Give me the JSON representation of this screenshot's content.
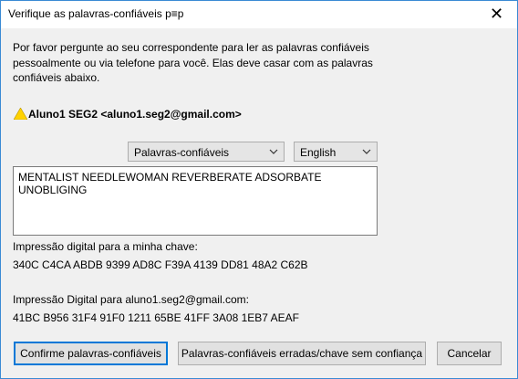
{
  "window": {
    "title": "Verifique as palavras-confiáveis p≡p",
    "close_glyph": "✕"
  },
  "intro_text": "Por favor pergunte ao seu correspondente para ler as palavras confiáveis pessoalmente ou via telefone para você. Elas deve casar com as palavras confiáveis abaixo.",
  "recipient": "Aluno1 SEG2 <aluno1.seg2@gmail.com>",
  "mode_select": {
    "value": "Palavras-confiáveis"
  },
  "language_select": {
    "value": "English"
  },
  "trustwords": "MENTALIST NEEDLEWOMAN REVERBERATE ADSORBATE UNOBLIGING",
  "own_fingerprint": {
    "label": "Impressão digital para a minha chave:",
    "value": "340C C4CA ABDB 9399 AD8C F39A 4139 DD81 48A2 C62B"
  },
  "partner_fingerprint": {
    "label": "Impressão Digital para aluno1.seg2@gmail.com:",
    "value": "41BC B956 31F4 91F0 1211 65BE 41FF 3A08 1EB7 AEAF"
  },
  "buttons": {
    "confirm": "Confirme palavras-confiáveis",
    "wrong": "Palavras-confiáveis erradas/chave sem confiança",
    "cancel": "Cancelar"
  },
  "icons": {
    "warning": "warning-triangle-icon",
    "dropdown": "chevron-down-icon",
    "close": "close-icon"
  },
  "colors": {
    "warning_yellow": "#ffd200",
    "accent_blue": "#0078d7"
  }
}
